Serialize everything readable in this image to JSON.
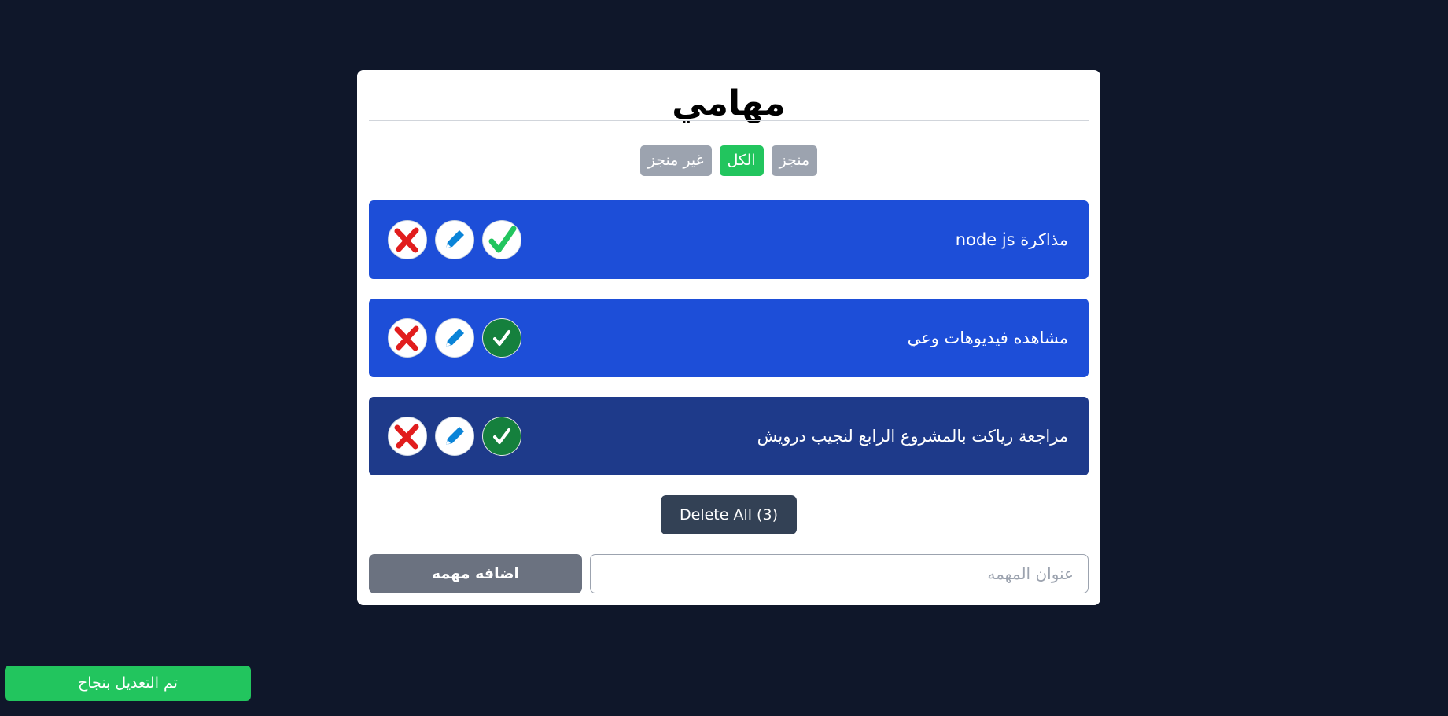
{
  "app": {
    "title": "مهامي"
  },
  "filters": [
    {
      "label": "منجز",
      "active": false
    },
    {
      "label": "الكل",
      "active": true
    },
    {
      "label": "غير منجز",
      "active": false
    }
  ],
  "tasks": [
    {
      "title": "مذاكرة node js",
      "completed": false
    },
    {
      "title": "مشاهده فيديوهات وعي",
      "completed": true
    },
    {
      "title": "مراجعة رياكت بالمشروع الرابع لنجيب درويش",
      "completed": true
    }
  ],
  "actions": {
    "delete_all_label": "Delete All (3)",
    "add_label": "اضافه مهمه",
    "input_placeholder": "عنوان المهمه",
    "input_value": ""
  },
  "toast": {
    "message": "تم التعديل بنجاح"
  },
  "icons": {
    "delete": "close-icon",
    "edit": "pencil-icon",
    "complete": "check-icon"
  },
  "colors": {
    "background": "#0f172a",
    "task": "#1d4ed8",
    "task_selected": "#1e3a8a",
    "active_filter": "#22c55e",
    "inactive_filter": "#9ca3af",
    "delete_icon": "#e11d1d",
    "edit_icon": "#0a84d8",
    "check_icon": "#22c55e",
    "toast": "#22c55e"
  }
}
